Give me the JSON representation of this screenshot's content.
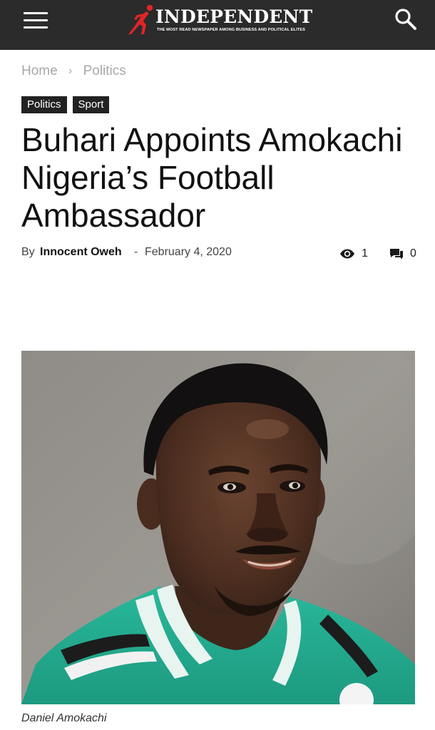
{
  "header": {
    "logo_text": "INDEPENDENT",
    "logo_tagline": "THE MOST READ NEWSPAPER AMONG BUSINESS AND POLITICAL ELITES",
    "menu_icon": "hamburger-menu-icon",
    "search_icon": "search-icon",
    "bar_color": "#2b2b2b",
    "brand_accent": "#e0252a"
  },
  "breadcrumb": {
    "home": "Home",
    "separator": "›",
    "current": "Politics"
  },
  "tags": [
    "Politics",
    "Sport"
  ],
  "article": {
    "title": "Buhari Appoints Amokachi Nigeria’s Football Ambassador",
    "by_label": "By",
    "author": "Innocent Oweh",
    "dash": "-",
    "date": "February 4, 2020",
    "views": "1",
    "comments": "0",
    "views_icon": "eye-icon",
    "comments_icon": "comment-icon",
    "image_caption": "Daniel Amokachi"
  }
}
